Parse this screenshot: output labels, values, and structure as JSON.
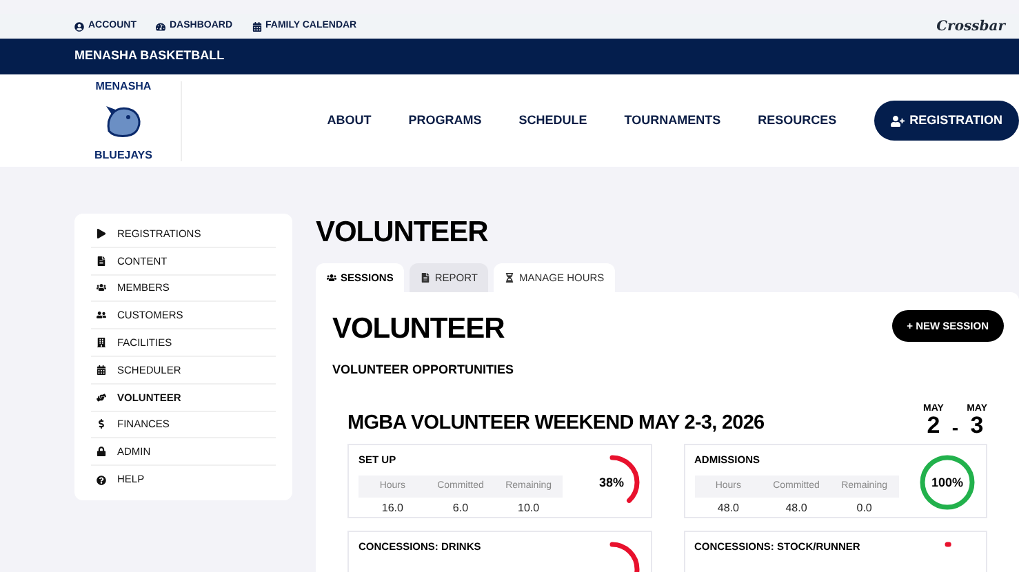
{
  "top_bar": {
    "links": [
      "ACCOUNT",
      "DASHBOARD",
      "FAMILY CALENDAR"
    ],
    "brand": "Crossbar"
  },
  "org_bar": {
    "title": "MENASHA BASKETBALL"
  },
  "logo": {
    "top": "MENASHA",
    "bottom": "BLUEJAYS"
  },
  "nav": {
    "items": [
      "ABOUT",
      "PROGRAMS",
      "SCHEDULE",
      "TOURNAMENTS",
      "RESOURCES"
    ],
    "button": "REGISTRATION"
  },
  "sidebar": {
    "items": [
      {
        "label": "REGISTRATIONS",
        "selected": false
      },
      {
        "label": "CONTENT",
        "selected": false
      },
      {
        "label": "MEMBERS",
        "selected": false
      },
      {
        "label": "CUSTOMERS",
        "selected": false
      },
      {
        "label": "FACILITIES",
        "selected": false
      },
      {
        "label": "SCHEDULER",
        "selected": false
      },
      {
        "label": "VOLUNTEER",
        "selected": true
      },
      {
        "label": "FINANCES",
        "selected": false
      },
      {
        "label": "ADMIN",
        "selected": false
      },
      {
        "label": "HELP",
        "selected": false
      }
    ]
  },
  "page_title": "VOLUNTEER",
  "tabs": [
    {
      "label": "SESSIONS",
      "selected": true,
      "hovered": false
    },
    {
      "label": "REPORT",
      "selected": false,
      "hovered": true
    },
    {
      "label": "MANAGE HOURS",
      "selected": false,
      "hovered": false
    }
  ],
  "panel": {
    "title": "VOLUNTEER",
    "new_button": "+ NEW SESSION",
    "subtitle": "VOLUNTEER OPPORTUNITIES"
  },
  "event": {
    "title": "MGBA VOLUNTEER WEEKEND MAY 2-3, 2026",
    "start_month": "MAY",
    "start_day": "2",
    "separator": "-",
    "end_month": "MAY",
    "end_day": "3",
    "sessions": [
      {
        "name": "SET UP",
        "columns": [
          "Hours",
          "Committed",
          "Remaining"
        ],
        "values": [
          "16.0",
          "6.0",
          "10.0"
        ],
        "percent": "38%",
        "level": 0.38
      },
      {
        "name": "ADMISSIONS",
        "columns": [
          "Hours",
          "Committed",
          "Remaining"
        ],
        "values": [
          "48.0",
          "48.0",
          "0.0"
        ],
        "percent": "100%",
        "level": 1
      },
      {
        "name": "CONCESSIONS: DRINKS",
        "level": 0.3
      },
      {
        "name": "CONCESSIONS: STOCK/RUNNER",
        "level": 0.01
      }
    ]
  }
}
